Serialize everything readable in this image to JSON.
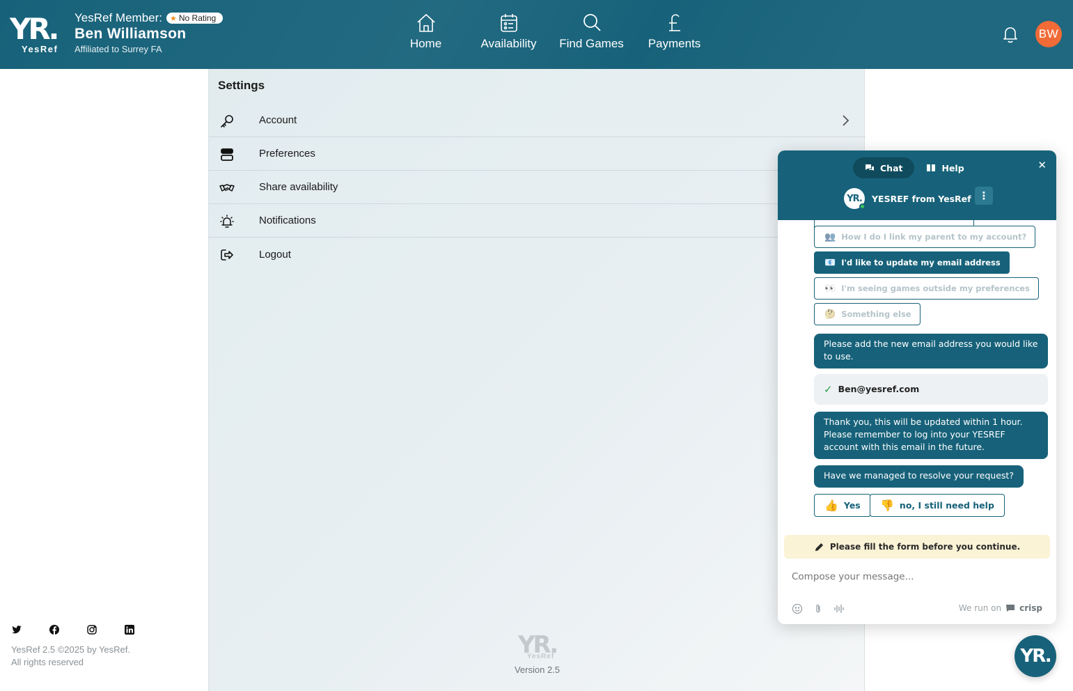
{
  "header": {
    "logo_mark": "YR.",
    "logo_sub": "YesRef",
    "member_label": "YesRef Member:",
    "rating_badge": "No Rating",
    "user_name": "Ben Williamson",
    "affiliation": "Affiliated to Surrey FA",
    "avatar_initials": "BW",
    "nav": [
      {
        "label": "Home",
        "icon": "home-icon"
      },
      {
        "label": "Availability",
        "icon": "calendar-icon"
      },
      {
        "label": "Find Games",
        "icon": "search-icon"
      },
      {
        "label": "Payments",
        "icon": "pound-icon"
      }
    ]
  },
  "settings": {
    "title": "Settings",
    "items": [
      {
        "label": "Account",
        "icon": "key-icon"
      },
      {
        "label": "Preferences",
        "icon": "toggle-icon"
      },
      {
        "label": "Share availability",
        "icon": "handshake-icon"
      },
      {
        "label": "Notifications",
        "icon": "alarm-bell-icon"
      },
      {
        "label": "Logout",
        "icon": "logout-icon"
      }
    ],
    "footer_logo": "YR.",
    "footer_logo_sub": "YesRef",
    "version": "Version 2.5"
  },
  "sidebar_footer": {
    "social": [
      "twitter-icon",
      "facebook-icon",
      "instagram-icon",
      "linkedin-icon"
    ],
    "copyright_line1": "YesRef 2.5 ©2025 by YesRef.",
    "copyright_line2": "All rights reserved"
  },
  "chat": {
    "tab_chat": "Chat",
    "tab_help": "Help",
    "agent_name": "YESREF from YesRef",
    "agent_avatar": "YR.",
    "options": [
      {
        "emoji": "👥",
        "label": "How I do I link my parent to my account?",
        "selected": false
      },
      {
        "emoji": "📧",
        "label": "I'd like to update my email address",
        "selected": true
      },
      {
        "emoji": "👀",
        "label": "I'm seeing games outside my preferences",
        "selected": false
      },
      {
        "emoji": "🤔",
        "label": "Something else",
        "selected": false
      }
    ],
    "msg_add_email": "Please add the new email address you would like to use.",
    "user_email": "Ben@yesref.com",
    "msg_thanks": "Thank you, this will be updated within 1 hour. Please remember to log into your YESREF account with this email in the future.",
    "msg_resolved": "Have we managed to resolve your request?",
    "resp_yes": "Yes",
    "resp_yes_emoji": "👍",
    "resp_no": "no, I still need help",
    "resp_no_emoji": "👎",
    "form_warning": "Please fill the form before you continue.",
    "compose_placeholder": "Compose your message...",
    "powered_by": "We run on",
    "powered_brand": "crisp",
    "launcher_logo": "YR."
  },
  "colors": {
    "brand": "#17627a",
    "avatar": "#f0652f",
    "badge_star": "#f28c1c",
    "warning_bg": "#fbf3d6"
  }
}
